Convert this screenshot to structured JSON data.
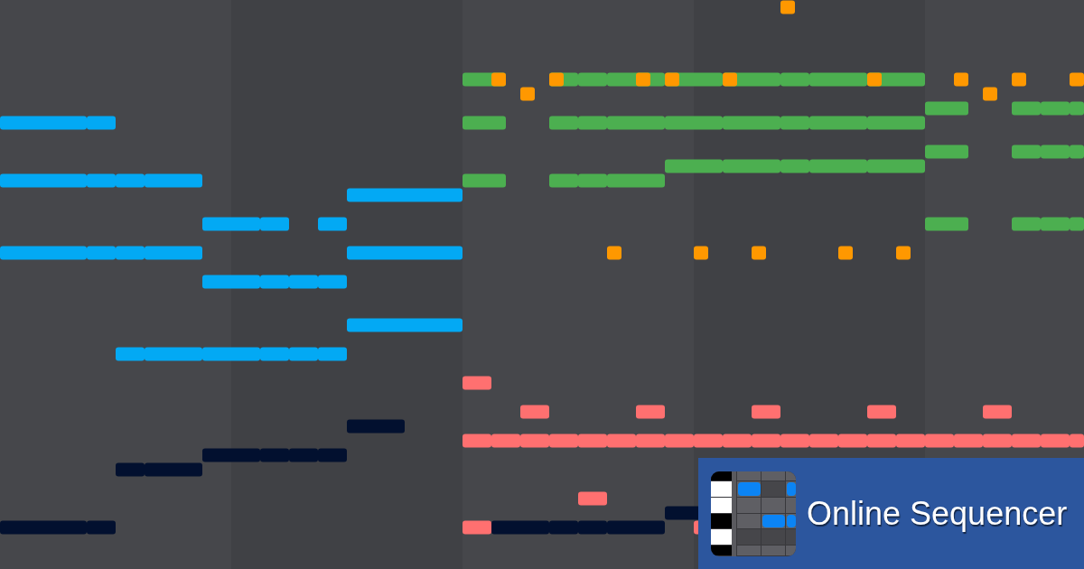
{
  "piano_roll": {
    "tracks": [
      {
        "color": "#03a9f4"
      },
      {
        "color": "#4caf50"
      },
      {
        "color": "#ff9800"
      },
      {
        "color": "#ff7070"
      },
      {
        "color": "#02102f"
      }
    ]
  },
  "banner": {
    "title": "Online Sequencer"
  }
}
